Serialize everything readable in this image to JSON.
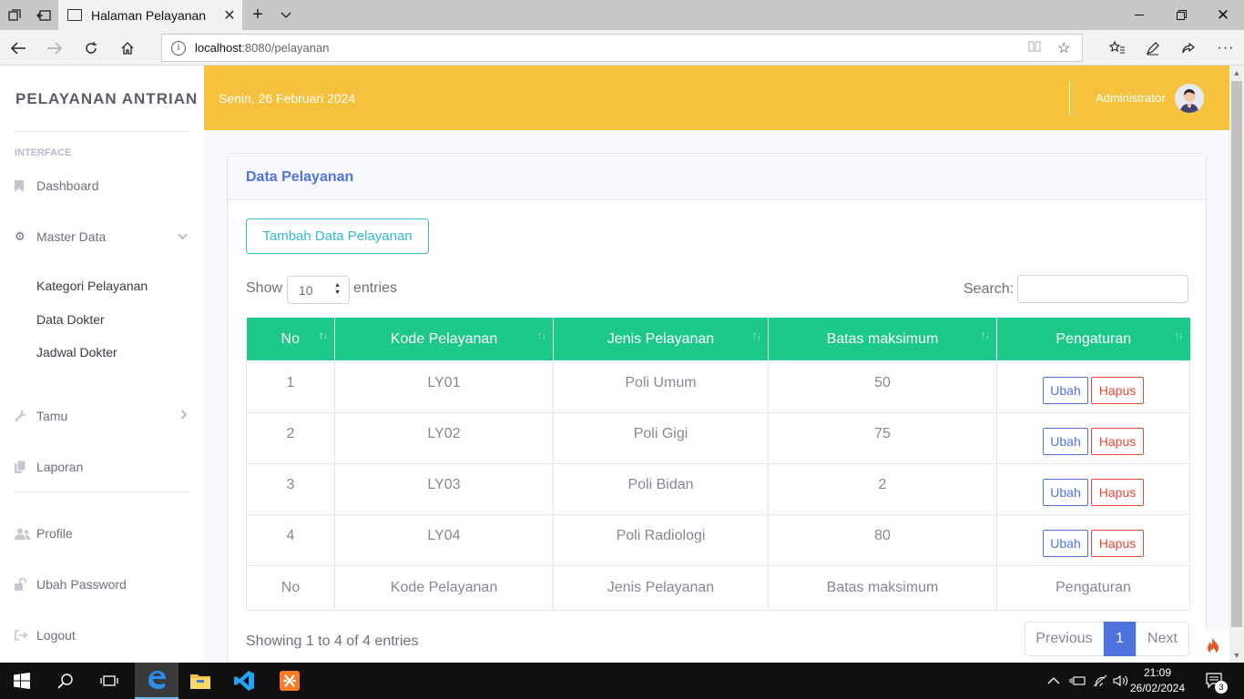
{
  "browser": {
    "tab_title": "Halaman Pelayanan",
    "url_host": "localhost",
    "url_rest": ":8080/pelayanan"
  },
  "sidebar": {
    "brand": "PELAYANAN ANTRIAN",
    "heading": "INTERFACE",
    "items": {
      "dashboard": "Dashboard",
      "master_data": "Master Data",
      "kategori": "Kategori Pelayanan",
      "dokter": "Data Dokter",
      "jadwal": "Jadwal Dokter",
      "tamu": "Tamu",
      "laporan": "Laporan",
      "profile": "Profile",
      "ubah_password": "Ubah Password",
      "logout": "Logout"
    }
  },
  "topbar": {
    "date": "Senin, 26 Februari 2024",
    "user": "Administrator"
  },
  "card": {
    "title": "Data Pelayanan",
    "add_button": "Tambah Data Pelayanan",
    "show_label": "Show",
    "page_length": "10",
    "entries_label": "entries",
    "search_label": "Search:",
    "info": "Showing 1 to 4 of 4 entries"
  },
  "table": {
    "headers": [
      "No",
      "Kode Pelayanan",
      "Jenis Pelayanan",
      "Batas maksimum",
      "Pengaturan"
    ],
    "rows": [
      [
        "1",
        "LY01",
        "Poli Umum",
        "50"
      ],
      [
        "2",
        "LY02",
        "Poli Gigi",
        "75"
      ],
      [
        "3",
        "LY03",
        "Poli Bidan",
        "2"
      ],
      [
        "4",
        "LY04",
        "Poli Radiologi",
        "80"
      ]
    ],
    "edit_label": "Ubah",
    "delete_label": "Hapus",
    "footer": [
      "No",
      "Kode Pelayanan",
      "Jenis Pelayanan",
      "Batas maksimum",
      "Pengaturan"
    ]
  },
  "pagination": {
    "previous": "Previous",
    "current": "1",
    "next": "Next"
  },
  "taskbar": {
    "time": "21:09",
    "date": "26/02/2024",
    "notification_count": "3"
  },
  "colors": {
    "topbar": "#f6c23e",
    "table_header": "#1cc88a",
    "primary": "#4e73df",
    "danger": "#e74a3b",
    "info": "#36b9cc"
  }
}
